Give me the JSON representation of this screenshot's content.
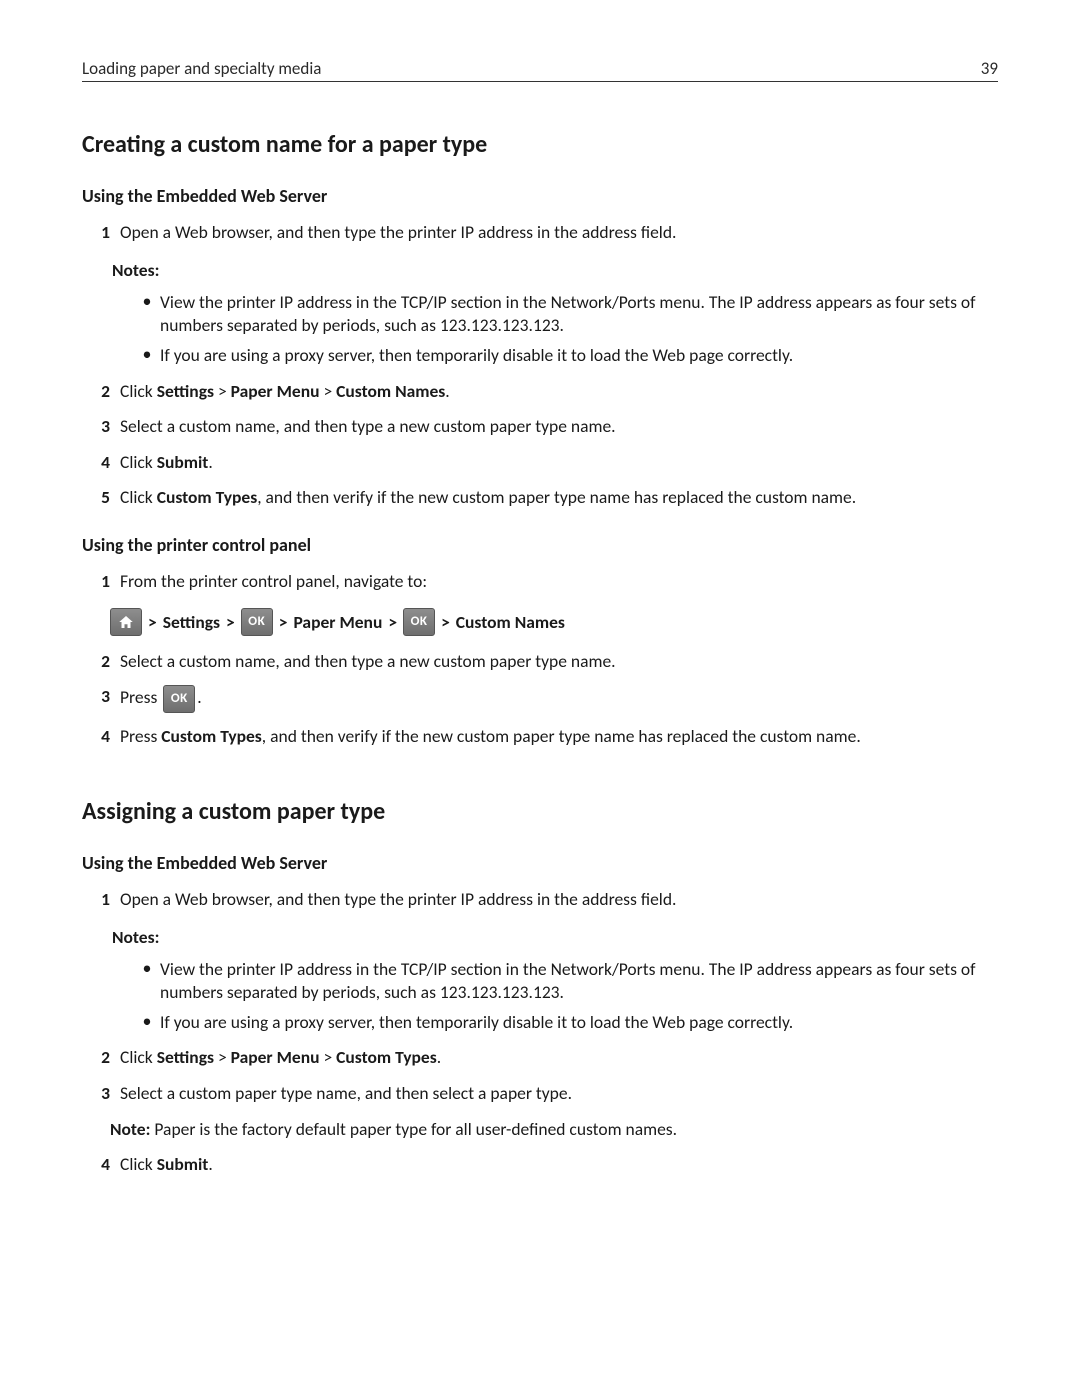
{
  "header": {
    "title": "Loading paper and specialty media",
    "page_number": "39"
  },
  "sect1": {
    "title": "Creating a custom name for a paper type",
    "a": {
      "title": "Using the Embedded Web Server",
      "step1": "Open a Web browser, and then type the printer IP address in the address field.",
      "notes_label": "Notes:",
      "note1": "View the printer IP address in the TCP/IP section in the Network/Ports menu. The IP address appears as four sets of numbers separated by periods, such as 123.123.123.123.",
      "note2": "If you are using a proxy server, then temporarily disable it to load the Web page correctly.",
      "step2_pre": "Click ",
      "step2_b1": "Settings",
      "step2_gt1": " > ",
      "step2_b2": "Paper Menu",
      "step2_gt2": " > ",
      "step2_b3": "Custom Names",
      "step2_post": ".",
      "step3": "Select a custom name, and then type a new custom paper type name.",
      "step4_pre": "Click ",
      "step4_b": "Submit",
      "step4_post": ".",
      "step5_pre": "Click ",
      "step5_b": "Custom Types",
      "step5_post": ", and then verify if the new custom paper type name has replaced the custom name."
    },
    "b": {
      "title": "Using the printer control panel",
      "step1": "From the printer control panel, navigate to:",
      "nav_gt": ">",
      "nav_settings": "Settings",
      "nav_paper_menu": "Paper Menu",
      "nav_custom_names": "Custom Names",
      "step2": "Select a custom name, and then type a new custom paper type name.",
      "step3_pre": "Press ",
      "step3_post": ".",
      "step4_pre": "Press ",
      "step4_b": "Custom Types",
      "step4_post": ", and then verify if the new custom paper type name has replaced the custom name."
    }
  },
  "sect2": {
    "title": "Assigning a custom paper type",
    "a": {
      "title": "Using the Embedded Web Server",
      "step1": "Open a Web browser, and then type the printer IP address in the address field.",
      "notes_label": "Notes:",
      "note1": "View the printer IP address in the TCP/IP section in the Network/Ports menu. The IP address appears as four sets of numbers separated by periods, such as 123.123.123.123.",
      "note2": "If you are using a proxy server, then temporarily disable it to load the Web page correctly.",
      "step2_pre": "Click ",
      "step2_b1": "Settings",
      "step2_gt1": " > ",
      "step2_b2": "Paper Menu",
      "step2_gt2": " > ",
      "step2_b3": "Custom Types",
      "step2_post": ".",
      "step3": "Select a custom paper type name, and then select a paper type.",
      "step3_note_b": "Note:",
      "step3_note": " Paper is the factory default paper type for all user-defined custom names.",
      "step4_pre": "Click ",
      "step4_b": "Submit",
      "step4_post": "."
    }
  },
  "icons": {
    "ok_label": "OK"
  }
}
